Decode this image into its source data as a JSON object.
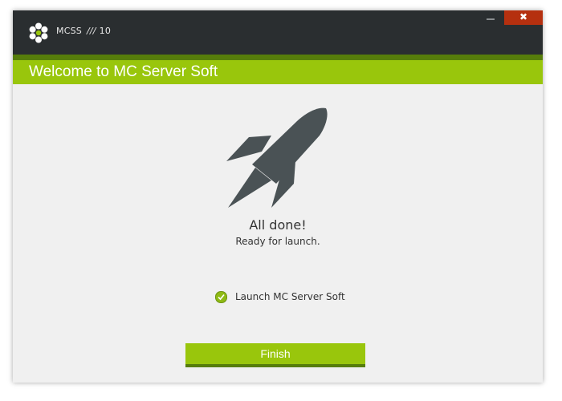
{
  "titlebar": {
    "app_name": "MCSS",
    "separator": "///",
    "version": "10",
    "close_glyph": "✖",
    "icons": [
      "logo-icon",
      "minimize-icon",
      "close-icon"
    ]
  },
  "header": {
    "title": "Welcome to MC Server Soft"
  },
  "main": {
    "icon": "rocket-icon",
    "done_title": "All done!",
    "done_subtitle": "Ready for launch.",
    "launch_checkbox": {
      "label": "Launch MC Server Soft",
      "checked": true
    },
    "finish_label": "Finish"
  },
  "colors": {
    "titlebar": "#2a2e30",
    "accent": "#99c60c",
    "accent_dark": "#567d0a",
    "close": "#b5300f",
    "rocket": "#4a5255",
    "background": "#f0f0f0"
  }
}
